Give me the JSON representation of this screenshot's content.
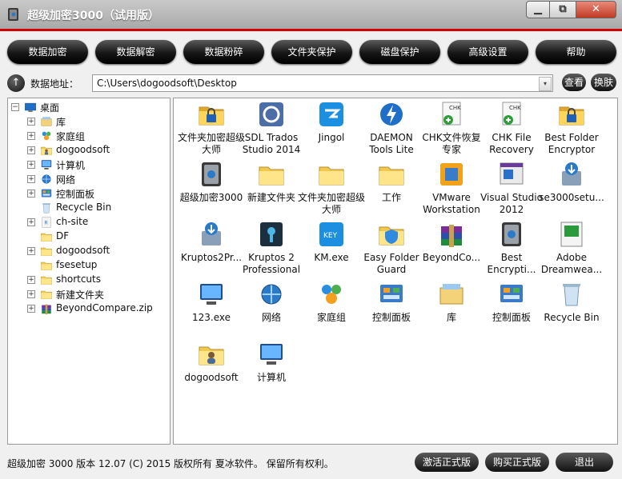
{
  "window": {
    "title": "超级加密3000（试用版）",
    "controls": {
      "minimize": "▁",
      "maximize": "⧉",
      "close": "✕"
    }
  },
  "toolbar": [
    "数据加密",
    "数据解密",
    "数据粉碎",
    "文件夹保护",
    "磁盘保护",
    "高级设置",
    "帮助"
  ],
  "address": {
    "up_icon": "↑",
    "label": "数据地址：",
    "value": "C:\\Users\\dogoodsoft\\Desktop",
    "dropdown_icon": "▾",
    "view_button": "查看",
    "skin_button": "换肤"
  },
  "tree": [
    {
      "label": "桌面",
      "icon": "desktop-icon",
      "level": 0,
      "expander": "−"
    },
    {
      "label": "库",
      "icon": "library-icon",
      "level": 1,
      "expander": "+"
    },
    {
      "label": "家庭组",
      "icon": "homegroup-icon",
      "level": 1,
      "expander": "+"
    },
    {
      "label": "dogoodsoft",
      "icon": "user-folder-icon",
      "level": 1,
      "expander": "+"
    },
    {
      "label": "计算机",
      "icon": "computer-icon",
      "level": 1,
      "expander": "+"
    },
    {
      "label": "网络",
      "icon": "network-icon",
      "level": 1,
      "expander": "+"
    },
    {
      "label": "控制面板",
      "icon": "control-panel-icon",
      "level": 1,
      "expander": "+"
    },
    {
      "label": "Recycle Bin",
      "icon": "recycle-bin-icon",
      "level": 1,
      "expander": ""
    },
    {
      "label": "ch-site",
      "icon": "ch-site-icon",
      "level": 1,
      "expander": "+"
    },
    {
      "label": "DF",
      "icon": "folder-icon",
      "level": 1,
      "expander": ""
    },
    {
      "label": "dogoodsoft",
      "icon": "folder-icon",
      "level": 1,
      "expander": "+"
    },
    {
      "label": "fsesetup",
      "icon": "folder-icon",
      "level": 1,
      "expander": ""
    },
    {
      "label": "shortcuts",
      "icon": "folder-icon",
      "level": 1,
      "expander": "+"
    },
    {
      "label": "新建文件夹",
      "icon": "folder-icon",
      "level": 1,
      "expander": "+"
    },
    {
      "label": "BeyondCompare.zip",
      "icon": "zip-icon",
      "level": 1,
      "expander": "+"
    }
  ],
  "files": [
    {
      "label": "文件夹加密超级大师",
      "icon": "folder-lock-icon"
    },
    {
      "label": "SDL Trados Studio 2014",
      "icon": "sdl-trados-icon"
    },
    {
      "label": "Jingol",
      "icon": "jingol-icon"
    },
    {
      "label": "DAEMON Tools Lite",
      "icon": "daemon-tools-icon"
    },
    {
      "label": "CHK文件恢复专家",
      "icon": "chk-recovery-icon"
    },
    {
      "label": "CHK File Recovery",
      "icon": "chk-file-icon"
    },
    {
      "label": "Best Folder Encryptor",
      "icon": "folder-lock-icon"
    },
    {
      "label": "超级加密3000",
      "icon": "safe-icon"
    },
    {
      "label": "新建文件夹",
      "icon": "folder-icon"
    },
    {
      "label": "文件夹加密超级大师",
      "icon": "folder-icon"
    },
    {
      "label": "工作",
      "icon": "folder-icon"
    },
    {
      "label": "VMware Workstation",
      "icon": "vmware-icon"
    },
    {
      "label": "Visual Studio 2012",
      "icon": "visual-studio-icon"
    },
    {
      "label": "se3000setu...",
      "icon": "installer-icon"
    },
    {
      "label": "Kruptos2Pr...",
      "icon": "installer-icon"
    },
    {
      "label": "Kruptos 2 Professional",
      "icon": "keyhole-icon"
    },
    {
      "label": "KM.exe",
      "icon": "key-icon"
    },
    {
      "label": "Easy Folder Guard",
      "icon": "shield-folder-icon"
    },
    {
      "label": "BeyondCo...",
      "icon": "zip-icon"
    },
    {
      "label": "Best Encrypti...",
      "icon": "safe-icon"
    },
    {
      "label": "Adobe Dreamwea...",
      "icon": "dreamweaver-icon"
    },
    {
      "label": "123.exe",
      "icon": "computer-icon"
    },
    {
      "label": "网络",
      "icon": "network-icon"
    },
    {
      "label": "家庭组",
      "icon": "homegroup-icon"
    },
    {
      "label": "控制面板",
      "icon": "control-panel-icon"
    },
    {
      "label": "库",
      "icon": "library-icon"
    },
    {
      "label": "控制面板",
      "icon": "control-panel-icon"
    },
    {
      "label": "Recycle Bin",
      "icon": "recycle-bin-icon"
    },
    {
      "label": "dogoodsoft",
      "icon": "user-folder-icon"
    },
    {
      "label": "计算机",
      "icon": "computer-icon"
    }
  ],
  "status": {
    "text": "超级加密 3000  版本 12.07  (C)  2015 版权所有 夏冰软件。 保留所有权利。",
    "activate_button": "激活正式版",
    "buy_button": "购买正式版",
    "exit_button": "退出"
  },
  "colors": {
    "accent": "#d40000",
    "button_dark": "#111111"
  }
}
